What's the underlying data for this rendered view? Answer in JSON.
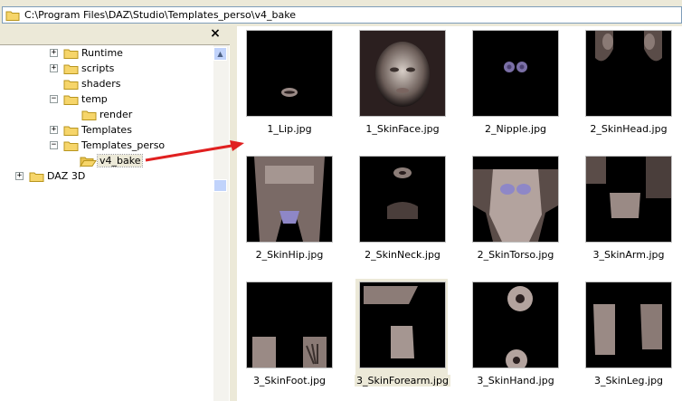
{
  "address": {
    "path": "C:\\Program Files\\DAZ\\Studio\\Templates_perso\\v4_bake"
  },
  "tree": {
    "close_label": "×",
    "items": [
      {
        "label": "Runtime",
        "expander": "+"
      },
      {
        "label": "scripts",
        "expander": "+"
      },
      {
        "label": "shaders",
        "expander": ""
      },
      {
        "label": "temp",
        "expander": "−"
      },
      {
        "label": "render",
        "expander": ""
      },
      {
        "label": "Templates",
        "expander": "+"
      },
      {
        "label": "Templates_perso",
        "expander": "−"
      },
      {
        "label": "v4_bake",
        "expander": "",
        "selected": true
      },
      {
        "label": "DAZ 3D",
        "expander": "+"
      }
    ]
  },
  "files": [
    {
      "name": "1_Lip.jpg",
      "preview": "lip"
    },
    {
      "name": "1_SkinFace.jpg",
      "preview": "face"
    },
    {
      "name": "2_Nipple.jpg",
      "preview": "nipple"
    },
    {
      "name": "2_SkinHead.jpg",
      "preview": "head"
    },
    {
      "name": "2_SkinHip.jpg",
      "preview": "hip"
    },
    {
      "name": "2_SkinNeck.jpg",
      "preview": "neck"
    },
    {
      "name": "2_SkinTorso.jpg",
      "preview": "torso"
    },
    {
      "name": "3_SkinArm.jpg",
      "preview": "arm"
    },
    {
      "name": "3_SkinFoot.jpg",
      "preview": "foot"
    },
    {
      "name": "3_SkinForearm.jpg",
      "preview": "forearm",
      "selected": true
    },
    {
      "name": "3_SkinHand.jpg",
      "preview": "hand"
    },
    {
      "name": "3_SkinLeg.jpg",
      "preview": "leg"
    }
  ],
  "colors": {
    "arrow": "#e02020",
    "folder": "#f6d56a",
    "selection": "#ece9d8"
  }
}
